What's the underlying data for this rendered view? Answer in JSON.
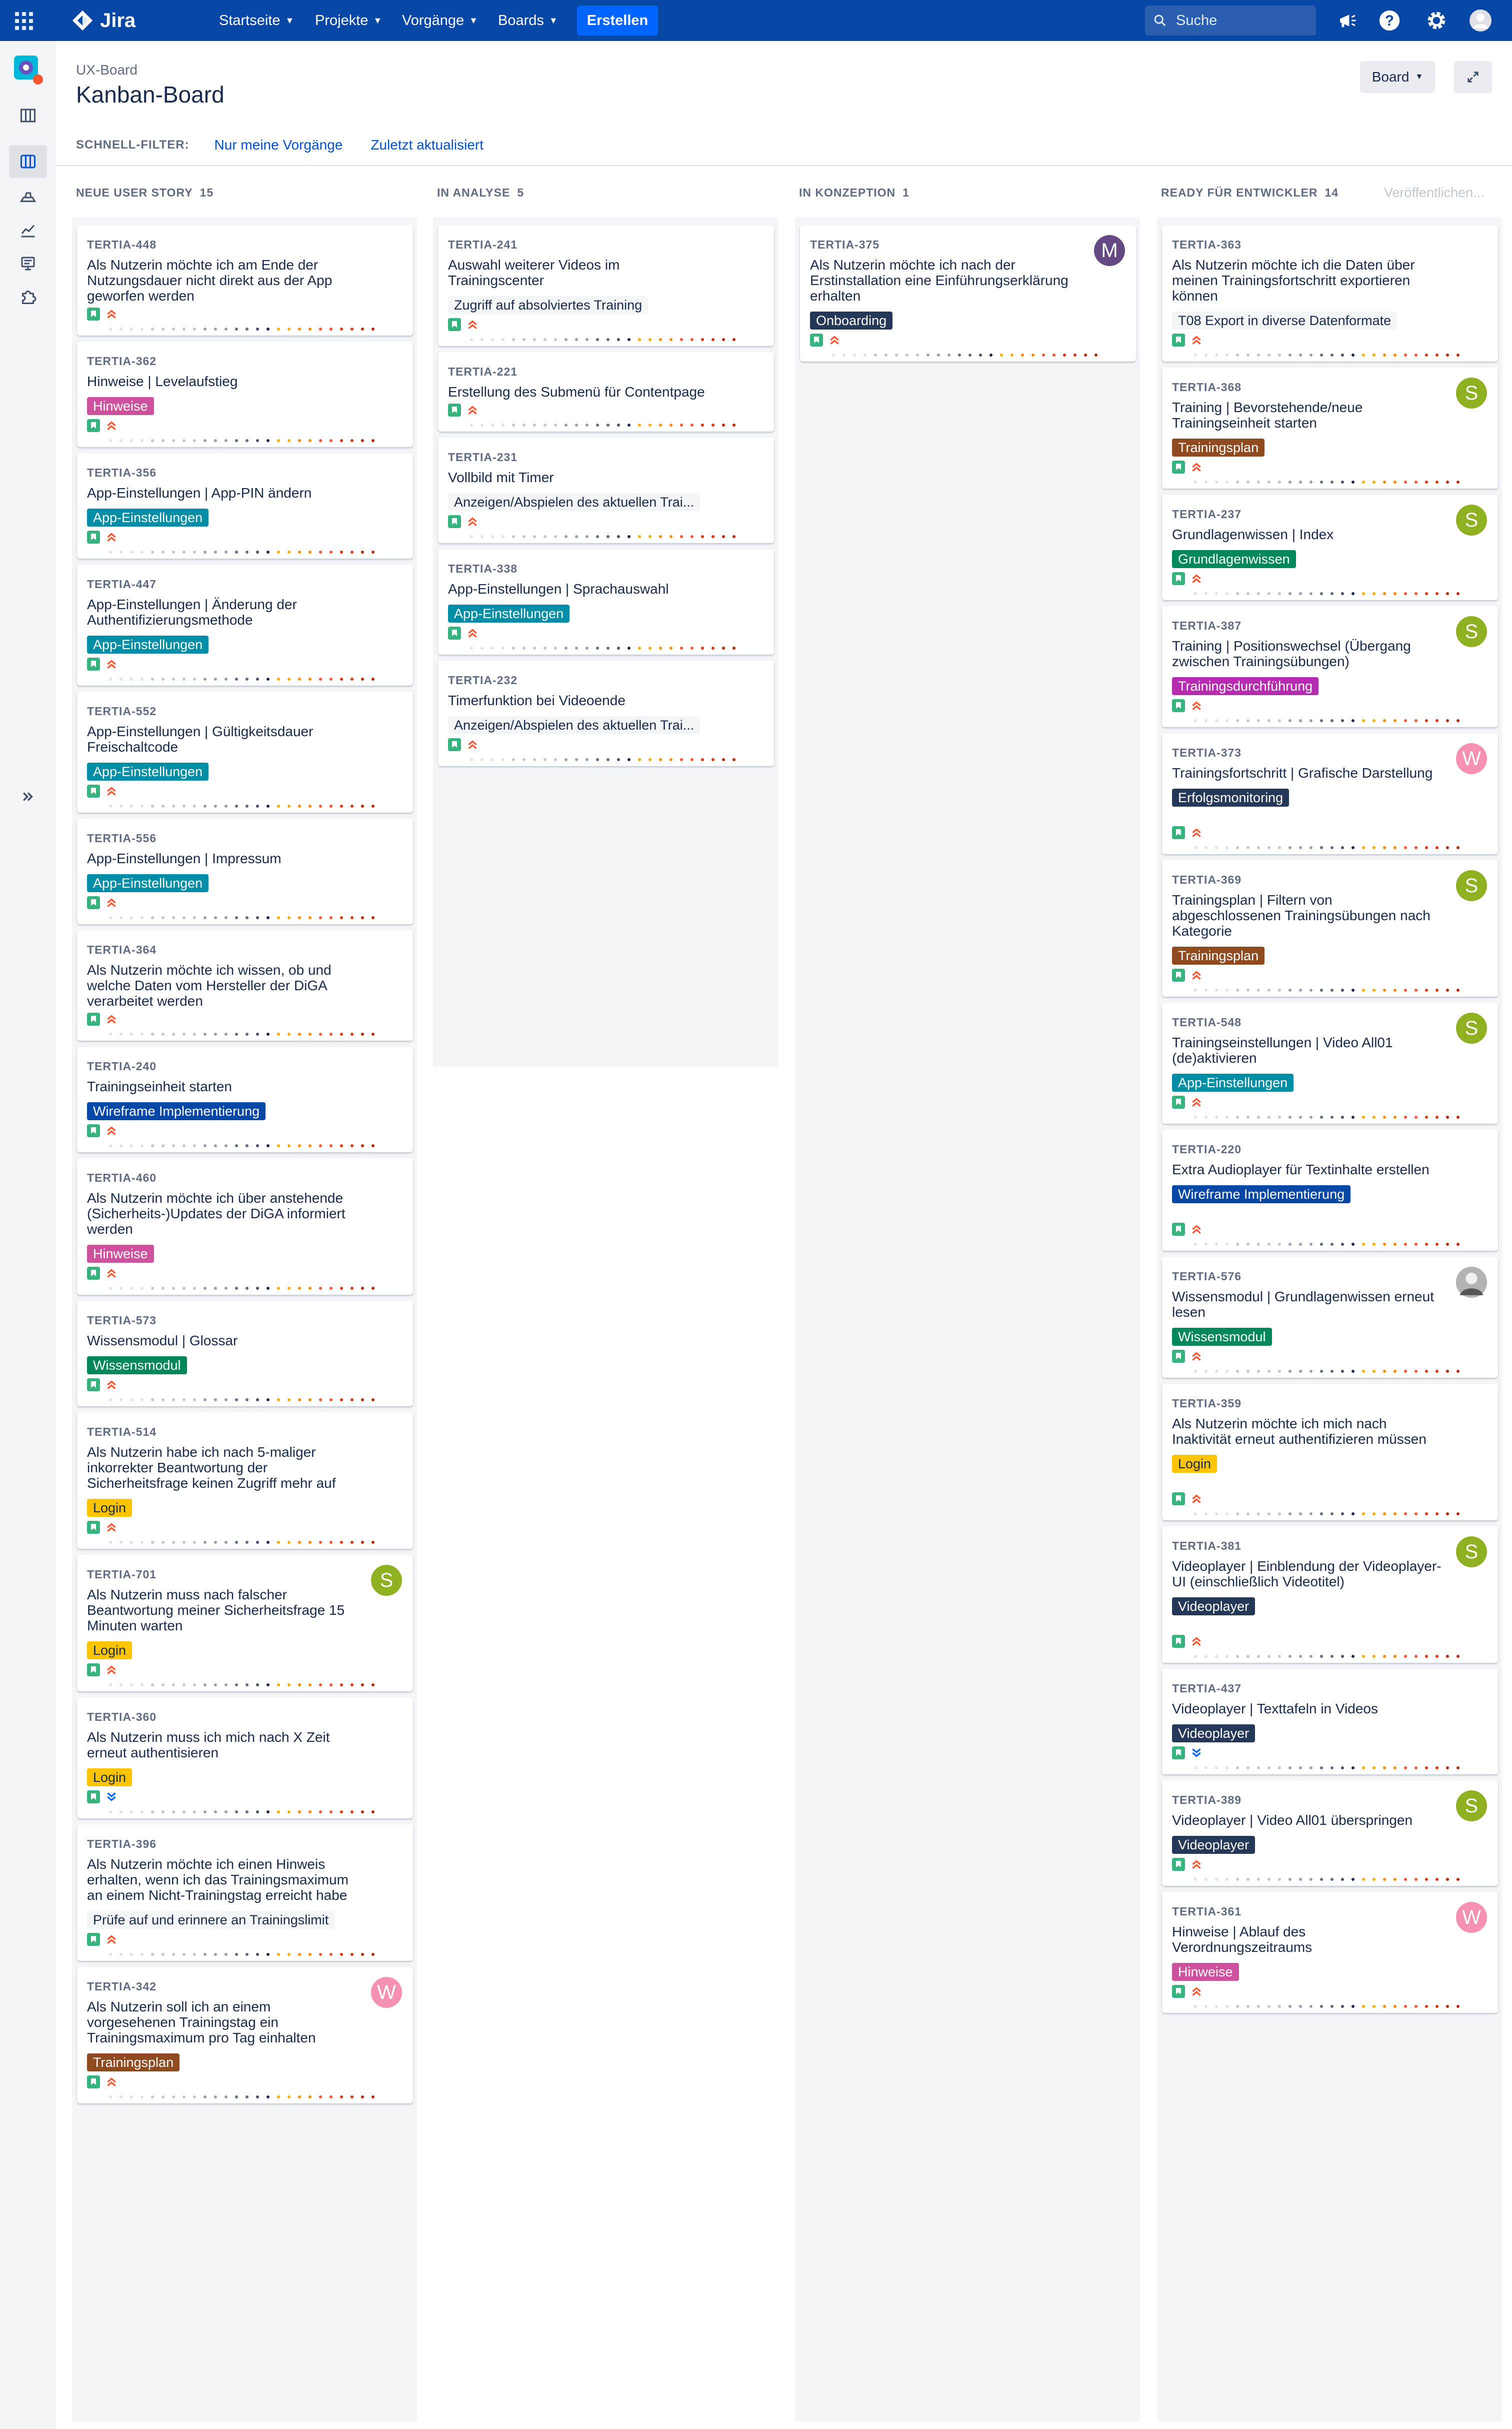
{
  "topbar": {
    "logo_text": "Jira",
    "nav": [
      "Startseite",
      "Projekte",
      "Vorgänge",
      "Boards"
    ],
    "create_label": "Erstellen",
    "search_placeholder": "Suche"
  },
  "header": {
    "breadcrumb": "UX-Board",
    "title": "Kanban-Board",
    "board_button": "Board"
  },
  "quick_filters": {
    "label": "SCHNELL-FILTER:",
    "items": [
      "Nur meine Vorgänge",
      "Zuletzt aktualisiert"
    ]
  },
  "publish_label": "Veröffentlichen...",
  "label_colors": {
    "Hinweise": "#cd519d",
    "App-Einstellungen": "#008da6",
    "Wireframe Implementierung": "#0747a6",
    "Wissensmodul": "#00875a",
    "Login": "#ffc400",
    "Trainingsplan": "#8f4a1f",
    "Onboarding": "#253858",
    "Grundlagenwissen": "#00875a",
    "Trainingsdurchführung": "#b52cb0",
    "Erfolgsmonitoring": "#253858",
    "Videoplayer": "#253858"
  },
  "avatar_colors": {
    "S": "#8eb021",
    "M": "#654982",
    "W": "#f691b2",
    "photo": "#8a8a8a"
  },
  "columns": [
    {
      "name": "NEUE USER STORY",
      "count": "15",
      "cards": [
        {
          "key": "TERTIA-448",
          "summary": "Als Nutzerin möchte ich am Ende der Nutzungsdauer nicht direkt aus der App geworfen werden",
          "label": "",
          "prio": "medium",
          "avatar": ""
        },
        {
          "key": "TERTIA-362",
          "summary": "Hinweise | Levelaufstieg",
          "label": "Hinweise",
          "prio": "medium",
          "avatar": ""
        },
        {
          "key": "TERTIA-356",
          "summary": "App-Einstellungen | App-PIN ändern",
          "label": "App-Einstellungen",
          "prio": "medium",
          "avatar": ""
        },
        {
          "key": "TERTIA-447",
          "summary": "App-Einstellungen | Änderung der Authentifizierungsmethode",
          "label": "App-Einstellungen",
          "prio": "medium",
          "avatar": ""
        },
        {
          "key": "TERTIA-552",
          "summary": "App-Einstellungen | Gültigkeitsdauer Freischaltcode",
          "label": "App-Einstellungen",
          "prio": "medium",
          "avatar": ""
        },
        {
          "key": "TERTIA-556",
          "summary": "App-Einstellungen | Impressum",
          "label": "App-Einstellungen",
          "prio": "medium",
          "avatar": ""
        },
        {
          "key": "TERTIA-364",
          "summary": "Als Nutzerin möchte ich wissen, ob und welche Daten vom Hersteller der DiGA verarbeitet werden",
          "label": "",
          "prio": "medium",
          "avatar": ""
        },
        {
          "key": "TERTIA-240",
          "summary": "Trainingseinheit starten",
          "label": "Wireframe Implementierung",
          "prio": "medium",
          "avatar": ""
        },
        {
          "key": "TERTIA-460",
          "summary": "Als Nutzerin möchte ich über anstehende (Sicherheits-)Updates der DiGA informiert werden",
          "label": "Hinweise",
          "prio": "medium",
          "avatar": ""
        },
        {
          "key": "TERTIA-573",
          "summary": "Wissensmodul | Glossar",
          "label": "Wissensmodul",
          "prio": "medium",
          "avatar": ""
        },
        {
          "key": "TERTIA-514",
          "summary": "Als Nutzerin habe ich nach 5-maliger inkorrekter Beantwortung der Sicherheitsfrage keinen Zugriff mehr auf die",
          "label": "Login",
          "prio": "medium",
          "avatar": ""
        },
        {
          "key": "TERTIA-701",
          "summary": "Als Nutzerin muss nach falscher Beantwortung meiner Sicherheitsfrage 15 Minuten warten",
          "label": "Login",
          "prio": "medium",
          "avatar": "S"
        },
        {
          "key": "TERTIA-360",
          "summary": "Als Nutzerin muss ich mich nach X Zeit erneut authentisieren",
          "label": "Login",
          "prio": "low",
          "avatar": ""
        },
        {
          "key": "TERTIA-396",
          "summary": "Als Nutzerin möchte ich einen Hinweis erhalten, wenn ich das Trainingsmaximum an einem Nicht-Trainingstag erreicht habe",
          "label": "Prüfe auf und erinnere an Trainingslimit",
          "prio": "medium",
          "avatar": ""
        },
        {
          "key": "TERTIA-342",
          "summary": "Als Nutzerin soll ich an einem vorgesehenen Trainingstag ein Trainingsmaximum pro Tag einhalten",
          "label": "Trainingsplan",
          "prio": "medium",
          "avatar": "W"
        }
      ]
    },
    {
      "name": "IN ANALYSE",
      "count": "5",
      "cards": [
        {
          "key": "TERTIA-241",
          "summary": "Auswahl weiterer Videos im Trainingscenter",
          "label": "Zugriff auf absolviertes Training",
          "prio": "medium",
          "avatar": ""
        },
        {
          "key": "TERTIA-221",
          "summary": "Erstellung des Submenü für Contentpage",
          "label": "",
          "prio": "medium",
          "avatar": ""
        },
        {
          "key": "TERTIA-231",
          "summary": "Vollbild mit Timer",
          "label": "Anzeigen/Abspielen des aktuellen Trai...",
          "prio": "medium",
          "avatar": ""
        },
        {
          "key": "TERTIA-338",
          "summary": "App-Einstellungen | Sprachauswahl",
          "label": "App-Einstellungen",
          "prio": "medium",
          "avatar": ""
        },
        {
          "key": "TERTIA-232",
          "summary": "Timerfunktion bei Videoende",
          "label": "Anzeigen/Abspielen des aktuellen Trai...",
          "prio": "medium",
          "avatar": ""
        }
      ]
    },
    {
      "name": "IN KONZEPTION",
      "count": "1",
      "cards": [
        {
          "key": "TERTIA-375",
          "summary": "Als Nutzerin möchte ich nach der Erstinstallation eine Einführungserklärung erhalten",
          "label": "Onboarding",
          "prio": "medium",
          "avatar": "M"
        }
      ]
    },
    {
      "name": "READY FÜR ENTWICKLER",
      "count": "14",
      "cards": [
        {
          "key": "TERTIA-363",
          "summary": "Als Nutzerin möchte ich die Daten über meinen Trainingsfortschritt exportieren können",
          "label": "T08 Export in diverse Datenformate",
          "prio": "medium",
          "avatar": ""
        },
        {
          "key": "TERTIA-368",
          "summary": "Training | Bevorstehende/neue Trainingseinheit starten",
          "label": "Trainingsplan",
          "prio": "medium",
          "avatar": "S"
        },
        {
          "key": "TERTIA-237",
          "summary": "Grundlagenwissen | Index",
          "label": "Grundlagenwissen",
          "prio": "medium",
          "avatar": "S"
        },
        {
          "key": "TERTIA-387",
          "summary": "Training | Positionswechsel (Übergang zwischen Trainingsübungen)",
          "label": "Trainingsdurchführung",
          "prio": "medium",
          "avatar": "S"
        },
        {
          "key": "TERTIA-373",
          "summary": "Trainingsfortschritt | Grafische Darstellung",
          "label": "Erfolgsmonitoring",
          "prio": "medium",
          "avatar": "W"
        },
        {
          "key": "TERTIA-369",
          "summary": "Trainingsplan | Filtern von abgeschlossenen Trainingsübungen nach Kategorie",
          "label": "Trainingsplan",
          "prio": "medium",
          "avatar": "S"
        },
        {
          "key": "TERTIA-548",
          "summary": "Trainingseinstellungen | Video All01 (de)aktivieren",
          "label": "App-Einstellungen",
          "prio": "medium",
          "avatar": "S"
        },
        {
          "key": "TERTIA-220",
          "summary": "Extra Audioplayer für Textinhalte erstellen",
          "label": "Wireframe Implementierung",
          "prio": "medium",
          "avatar": ""
        },
        {
          "key": "TERTIA-576",
          "summary": "Wissensmodul | Grundlagenwissen erneut lesen",
          "label": "Wissensmodul",
          "prio": "medium",
          "avatar": "photo"
        },
        {
          "key": "TERTIA-359",
          "summary": "Als Nutzerin möchte ich mich nach Inaktivität erneut authentifizieren müssen",
          "label": "Login",
          "prio": "medium",
          "avatar": ""
        },
        {
          "key": "TERTIA-381",
          "summary": "Videoplayer | Einblendung der Videoplayer-UI (einschließlich Videotitel)",
          "label": "Videoplayer",
          "prio": "medium",
          "avatar": "S"
        },
        {
          "key": "TERTIA-437",
          "summary": "Videoplayer | Texttafeln in Videos",
          "label": "Videoplayer",
          "prio": "low",
          "avatar": ""
        },
        {
          "key": "TERTIA-389",
          "summary": "Videoplayer | Video All01 überspringen",
          "label": "Videoplayer",
          "prio": "medium",
          "avatar": "S"
        },
        {
          "key": "TERTIA-361",
          "summary": "Hinweise | Ablauf des Verordnungszeitraums",
          "label": "Hinweise",
          "prio": "medium",
          "avatar": "W"
        }
      ]
    }
  ]
}
